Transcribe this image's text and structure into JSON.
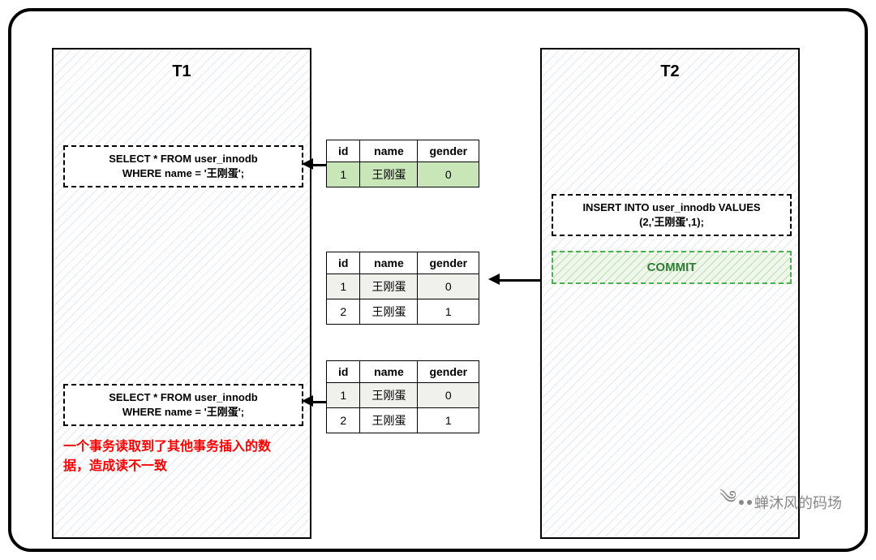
{
  "titles": {
    "t1": "T1",
    "t2": "T2"
  },
  "sql": {
    "select_line1": "SELECT * FROM user_innodb",
    "select_line2": "WHERE name = '王刚蛋';",
    "insert_line1": "INSERT INTO user_innodb VALUES",
    "insert_line2": "(2,'王刚蛋',1);",
    "commit": "COMMIT"
  },
  "headers": {
    "id": "id",
    "name": "name",
    "gender": "gender"
  },
  "tables": {
    "t1_result": {
      "rows": [
        {
          "id": "1",
          "name": "王刚蛋",
          "gender": "0"
        }
      ]
    },
    "after_insert": {
      "rows": [
        {
          "id": "1",
          "name": "王刚蛋",
          "gender": "0"
        },
        {
          "id": "2",
          "name": "王刚蛋",
          "gender": "1"
        }
      ]
    },
    "t1_second": {
      "rows": [
        {
          "id": "1",
          "name": "王刚蛋",
          "gender": "0"
        },
        {
          "id": "2",
          "name": "王刚蛋",
          "gender": "1"
        }
      ]
    }
  },
  "warning": "一个事务读取到了其他事务插入的数据，造成读不一致",
  "watermark": "蝉沐风的码场"
}
